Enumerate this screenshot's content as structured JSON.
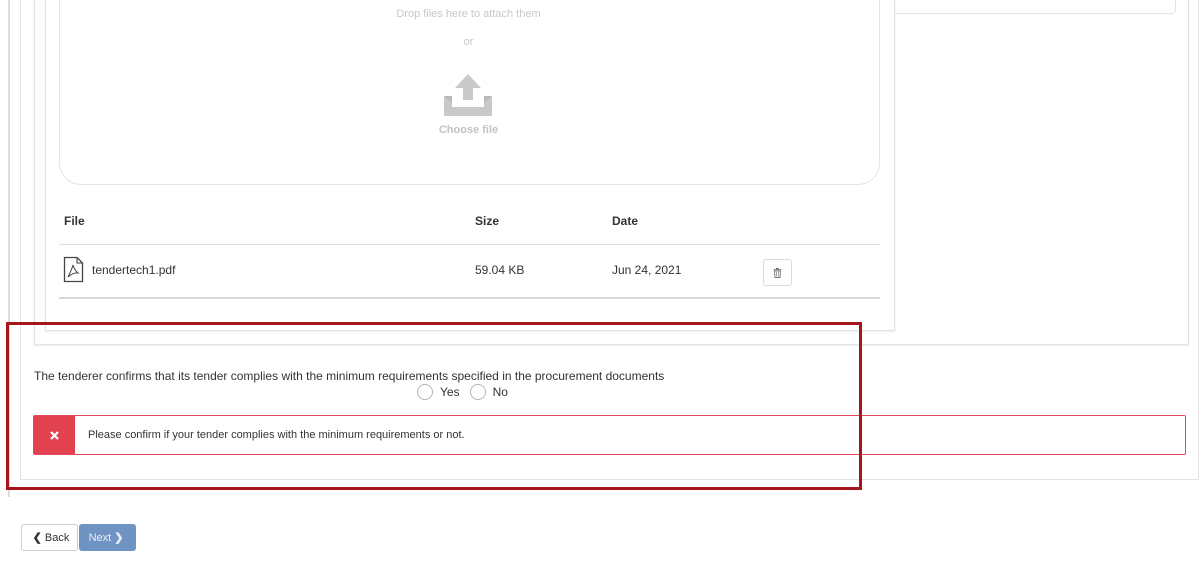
{
  "upload": {
    "drop_text": "Drop files here to attach them",
    "or_text": "or",
    "choose_label": "Choose file",
    "upload_icon": "upload-tray-icon"
  },
  "file_table": {
    "headers": [
      "File",
      "Size",
      "Date"
    ],
    "rows": [
      {
        "name": "tendertech1.pdf",
        "size": "59.04 KB",
        "date": "Jun 24, 2021",
        "icon": "pdf-file-icon",
        "action_icon": "trash-icon"
      }
    ]
  },
  "confirmation": {
    "question": "The tenderer confirms that its tender complies with the minimum requirements specified in the procurement documents",
    "options": [
      "Yes",
      "No"
    ],
    "error_icon": "close-x-icon",
    "error_message": "Please confirm if your tender complies with the minimum requirements or not.",
    "error_color": "#e2414f"
  },
  "nav": {
    "back_label": "Back",
    "next_label": "Next"
  },
  "colors": {
    "highlight": "#a4161a",
    "next_button": "#6f94c3"
  }
}
